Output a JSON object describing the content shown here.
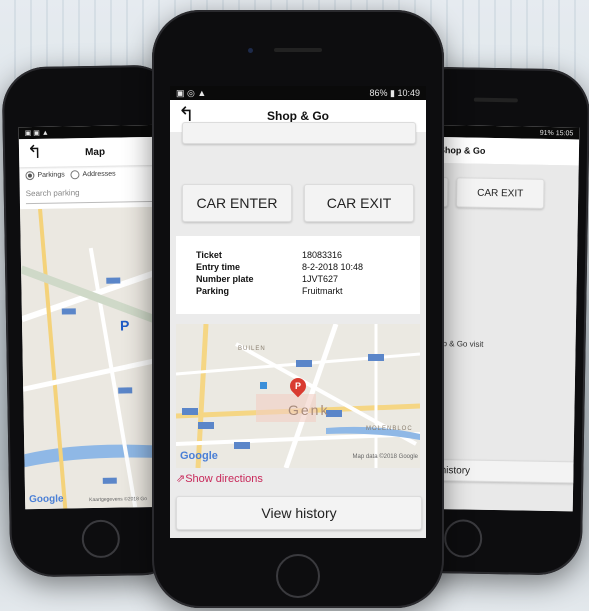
{
  "left_phone": {
    "title": "Map",
    "radio_parkings": "Parkings",
    "radio_addresses": "Addresses",
    "search_placeholder": "Search parking",
    "map_logo": "Google",
    "map_footer": "Kaartgegevens ©2018 Go"
  },
  "center_phone": {
    "status_time": "10:49",
    "status_battery": "86%",
    "title": "Shop & Go",
    "car_enter": "CAR ENTER",
    "car_exit": "CAR EXIT",
    "ticket_label": "Ticket",
    "ticket_value": "18083316",
    "entry_label": "Entry time",
    "entry_value": "8-2-2018 10:48",
    "plate_label": "Number plate",
    "plate_value": "1JVT627",
    "parking_label": "Parking",
    "parking_value": "Fruitmarkt",
    "map_city": "Genk",
    "map_area_1": "BUILEN",
    "map_area_2": "MOLENBLOC",
    "map_logo": "Google",
    "map_attribution": "Map data ©2018 Google",
    "show_directions": "Show directions",
    "view_history": "View history"
  },
  "right_phone": {
    "status_time": "15:05",
    "status_battery": "91%",
    "title": "Shop & Go",
    "car_enter_partial": "R",
    "car_exit": "CAR EXIT",
    "active_text": "tive Shop & Go visit",
    "view_history": "View history"
  },
  "colors": {
    "accent_pink": "#c8285a",
    "map_road_blue": "#5b86c9",
    "map_water": "#8fb8e6",
    "pin_red": "#d93b30"
  }
}
